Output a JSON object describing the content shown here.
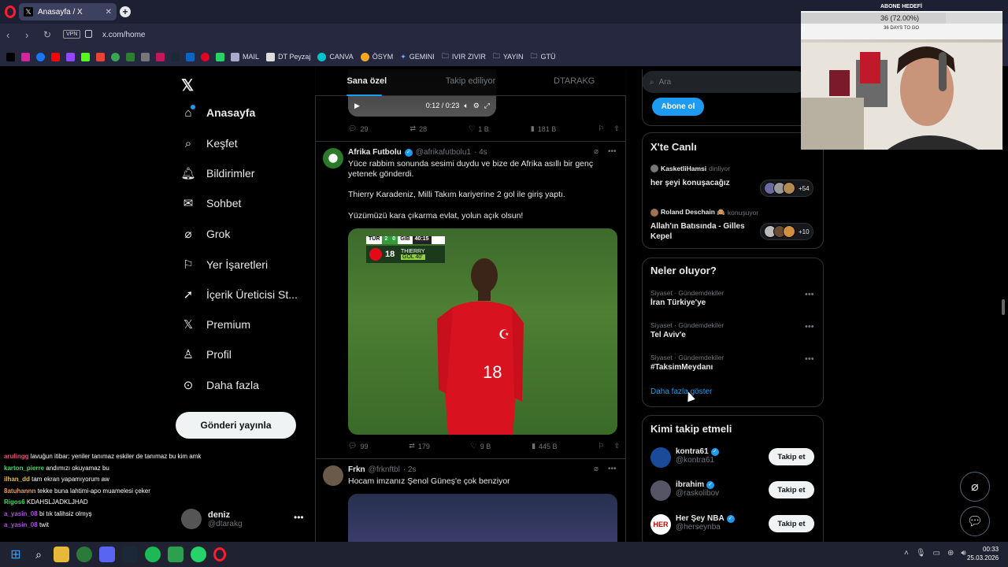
{
  "browser": {
    "tab_title": "Anasayfa / X",
    "url": "x.com/home",
    "vpn": "VPN",
    "bookmarks": [
      "MAIL",
      "DT Peyzaj",
      "CANVA",
      "ÖSYM",
      "GEMINI",
      "IVIR ZIVIR",
      "YAYIN",
      "GTÜ"
    ]
  },
  "nav": {
    "items": [
      "Anasayfa",
      "Keşfet",
      "Bildirimler",
      "Sohbet",
      "Grok",
      "Yer İşaretleri",
      "İçerik Üreticisi St...",
      "Premium",
      "Profil",
      "Daha fazla"
    ],
    "post_button": "Gönderi yayınla",
    "user_name": "deniz",
    "user_handle": "@dtarakg"
  },
  "timeline": {
    "tabs": [
      "Sana özel",
      "Takip ediliyor",
      "DTARAKG"
    ],
    "video1": {
      "time": "0:12 / 0:23",
      "replies": "29",
      "reposts": "28",
      "likes": "1 B",
      "views": "181 B"
    },
    "tweet1": {
      "name": "Afrika Futbolu",
      "handle": "@afrikafutbolu1",
      "time": "· 4s",
      "p1": "Yüce rabbim sonunda sesimi duydu ve bize de Afrika asıllı bir genç yetenek gönderdi.",
      "p2": "Thierry Karadeniz, Milli Takım kariyerine 2 gol ile giriş yaptı.",
      "p3": "Yüzümüzü kara çıkarma evlat, yolun açık olsun!",
      "replies": "99",
      "reposts": "179",
      "likes": "9 B",
      "views": "445 B",
      "score": {
        "team1": "TÜR",
        "s1": "2",
        "s2": "0",
        "team2": "GIB",
        "clock": "40:15",
        "number": "18",
        "player": "THIERRY",
        "goal": "GOL 40'"
      },
      "jersey": "18"
    },
    "tweet2": {
      "name": "Frkn",
      "handle": "@frknftbl",
      "time": "· 2s",
      "text": "Hocam imzanız Şenol Güneş'e çok benziyor"
    }
  },
  "sidebar": {
    "search_placeholder": "Ara",
    "subscribe": "Abone ol",
    "live": {
      "title": "X'te Canlı",
      "items": [
        {
          "host": "KasketliHamsi",
          "status": "dinliyor",
          "title": "her şeyi konuşacağız",
          "count": "+54"
        },
        {
          "host": "Roland Deschain 🙈",
          "status": "konuşuyor",
          "title": "Allah'ın Batısında - Gilles Kepel",
          "count": "+10"
        }
      ]
    },
    "trends": {
      "title": "Neler oluyor?",
      "items": [
        {
          "category": "Siyaset · Gündemdekiler",
          "name": "İran Türkiye'ye"
        },
        {
          "category": "Siyaset · Gündemdekiler",
          "name": "Tel Aviv'e"
        },
        {
          "category": "Siyaset · Gündemdekiler",
          "name": "#TaksimMeydanı"
        }
      ],
      "more": "Daha fazla göster"
    },
    "who_to_follow": {
      "title": "Kimi takip etmeli",
      "button": "Takip et",
      "items": [
        {
          "name": "kontra61",
          "handle": "@kontra61"
        },
        {
          "name": "ibrahim",
          "handle": "@raskolibov"
        },
        {
          "name": "Her Şey NBA",
          "handle": "@herseynba"
        }
      ]
    }
  },
  "overlay": {
    "goal_label": "ABONE HEDEFİ",
    "goal_text": "36 (72.00%)",
    "goal_days": "36 DAYS TO GO",
    "goal_min": "0",
    "goal_progress": 0.72,
    "chat": [
      {
        "user": "arulingg",
        "color": "#e0507a",
        "msg": "lavuğun itibar: yeniler tanımaz eskiler de tanımaz bu kim amk"
      },
      {
        "user": "karton_pierre",
        "color": "#44d66a",
        "msg": "andımızı okuyamaz bu"
      },
      {
        "user": "ilhan_dd",
        "color": "#e8c040",
        "msg": "tam ekran yapamıyorum aw"
      },
      {
        "user": "8atuhannn",
        "color": "#e0a060",
        "msg": "tekke buna lahtimi-apo muamelesi çeker"
      },
      {
        "user": "Rigos6",
        "color": "#44d66a",
        "msg": "KDAHSLJADKLJHAD"
      },
      {
        "user": "a_yasin_08",
        "color": "#b050e0",
        "msg": "bi tık talihsiz olmyş"
      },
      {
        "user": "a_yasin_08",
        "color": "#b050e0",
        "msg": "twit"
      }
    ]
  },
  "taskbar": {
    "time": "00:33",
    "date": "25.03.2026"
  }
}
